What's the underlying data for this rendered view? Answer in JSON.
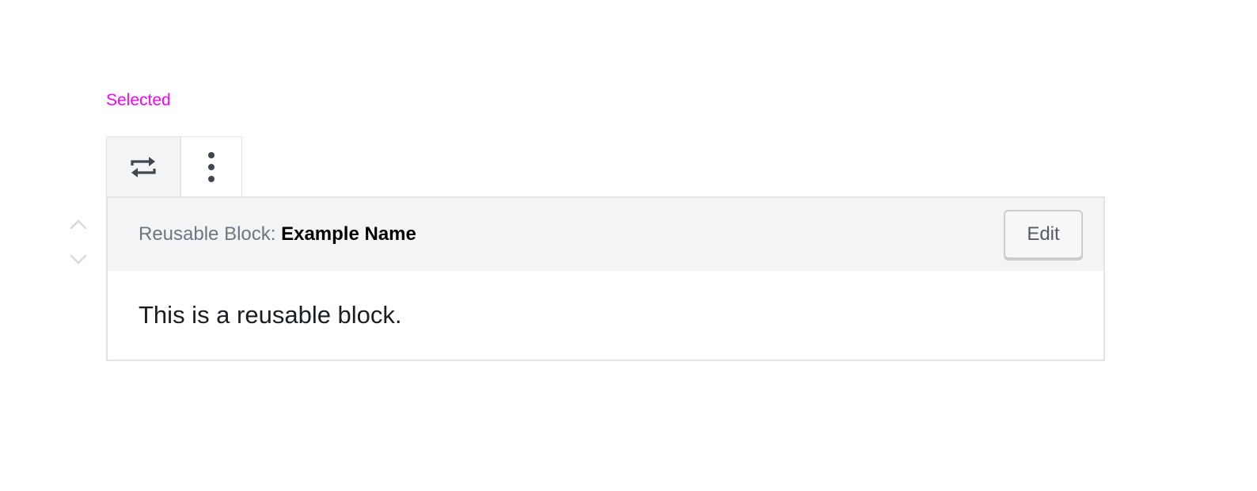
{
  "state_label": "Selected",
  "mover": {
    "up_icon": "chevron-up-icon",
    "down_icon": "chevron-down-icon"
  },
  "toolbar": {
    "switcher_icon": "repeat-arrows-icon",
    "more_icon": "vertical-ellipsis-icon"
  },
  "block": {
    "label_prefix": "Reusable Block: ",
    "name": "Example Name",
    "edit_label": "Edit",
    "content": "This is a reusable block."
  },
  "colors": {
    "state_label": "#ff00ff",
    "border": "#e2e4e7",
    "header_bg": "#f3f4f5",
    "title_muted": "#6c7781",
    "icon": "#40464d",
    "mover_icon": "#d6d9dd"
  }
}
